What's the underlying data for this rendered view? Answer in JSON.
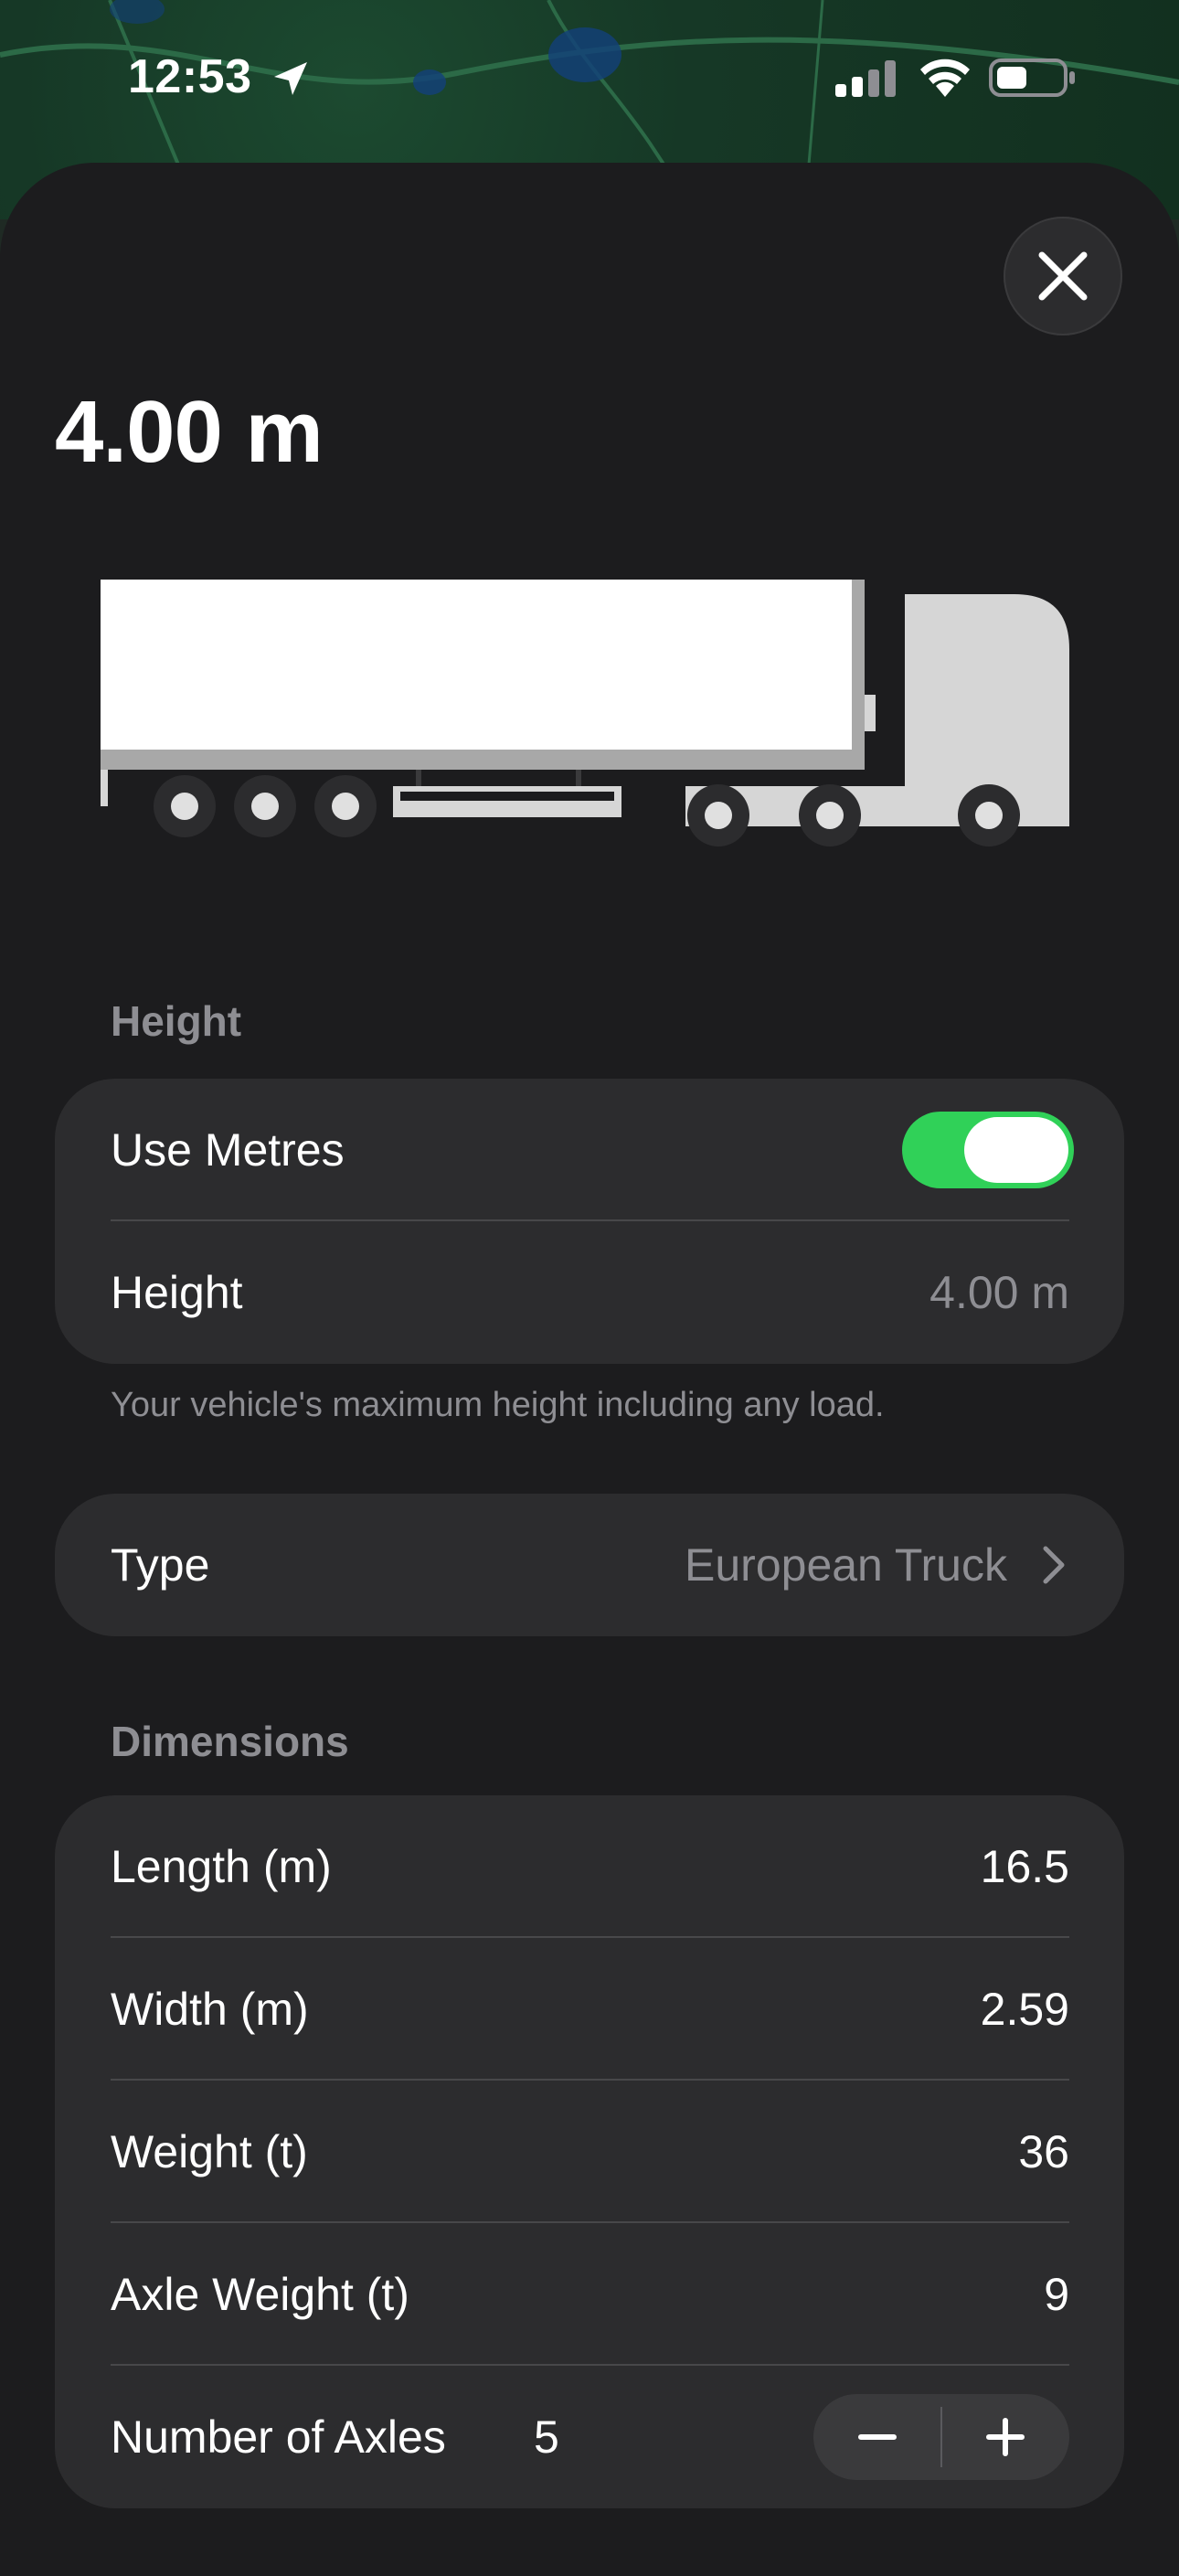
{
  "status_bar": {
    "time": "12:53",
    "icons": [
      "location-arrow-icon",
      "cellular-signal-icon",
      "wifi-icon",
      "battery-icon"
    ]
  },
  "sheet": {
    "title": "4.00 m",
    "close_icon": "close-icon"
  },
  "height_section": {
    "header": "Height",
    "use_metres_label": "Use Metres",
    "use_metres_on": true,
    "height_label": "Height",
    "height_value": "4.00 m",
    "footnote": "Your vehicle's maximum height including any load."
  },
  "type_row": {
    "label": "Type",
    "value": "European Truck"
  },
  "dimensions": {
    "header": "Dimensions",
    "rows": [
      {
        "label": "Length (m)",
        "value": "16.5"
      },
      {
        "label": "Width (m)",
        "value": "2.59"
      },
      {
        "label": "Weight (t)",
        "value": "36"
      },
      {
        "label": "Axle Weight (t)",
        "value": "9"
      }
    ],
    "axles_label": "Number of Axles",
    "axles_value": "5",
    "minus_symbol": "−",
    "plus_symbol": "+"
  },
  "colors": {
    "accent_toggle": "#30d158",
    "sheet_bg": "#1c1c1e",
    "card_bg": "#2c2c2e",
    "secondary_text": "#8e8e93"
  }
}
